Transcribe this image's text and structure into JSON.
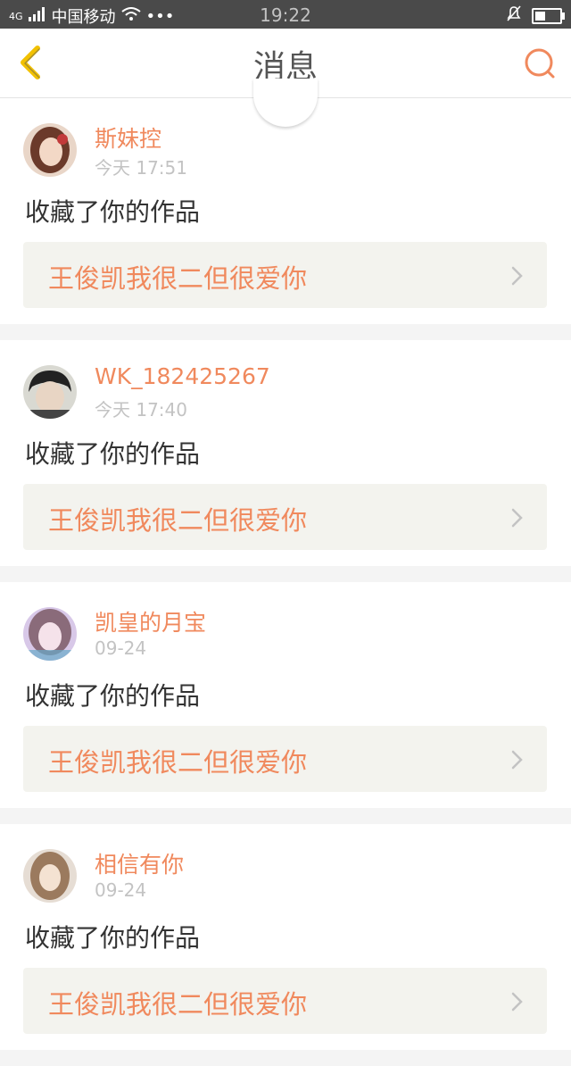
{
  "status_bar": {
    "network": "4G",
    "carrier": "中国移动",
    "more": "•••",
    "time": "19:22"
  },
  "nav": {
    "title": "消息"
  },
  "colors": {
    "accent": "#f0895d",
    "back": "#f2c100"
  },
  "notifications": [
    {
      "username": "斯妹控",
      "time": "今天 17:51",
      "action": "收藏了你的作品",
      "work_title": "王俊凯我很二但很爱你"
    },
    {
      "username": "WK_182425267",
      "time": "今天 17:40",
      "action": "收藏了你的作品",
      "work_title": "王俊凯我很二但很爱你"
    },
    {
      "username": "凯皇的月宝",
      "time": "09-24",
      "action": "收藏了你的作品",
      "work_title": "王俊凯我很二但很爱你"
    },
    {
      "username": "相信有你",
      "time": "09-24",
      "action": "收藏了你的作品",
      "work_title": "王俊凯我很二但很爱你"
    }
  ]
}
